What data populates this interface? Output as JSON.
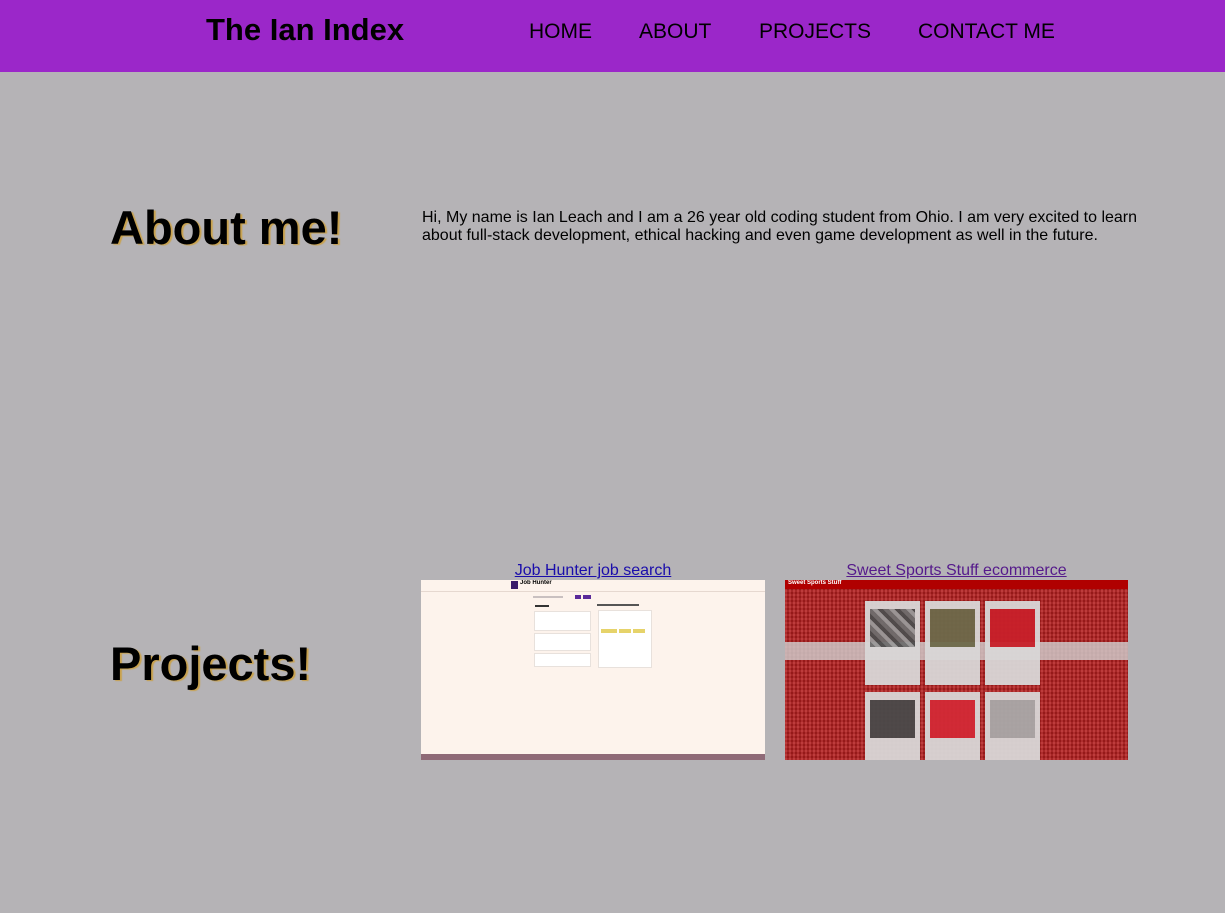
{
  "header": {
    "site_title": "The Ian Index",
    "nav": [
      "HOME",
      "ABOUT",
      "PROJECTS",
      "CONTACT ME"
    ]
  },
  "about": {
    "heading": "About me!",
    "text": "Hi, My name is Ian Leach and I am a 26 year old coding student from Ohio. I am very excited to learn about full-stack development, ethical hacking and even game development as well in the future."
  },
  "projects": {
    "heading": "Projects!",
    "items": [
      {
        "title": "Job Hunter job search",
        "thumb_title": "Job Hunter"
      },
      {
        "title": "Sweet Sports Stuff ecommerce",
        "thumb_title": "Sweet Sports Stuff"
      }
    ]
  },
  "colors": {
    "header_bg": "#9b27c9",
    "page_bg": "#b5b3b6",
    "link": "#1a0dab",
    "link_visited": "#551a8b"
  }
}
